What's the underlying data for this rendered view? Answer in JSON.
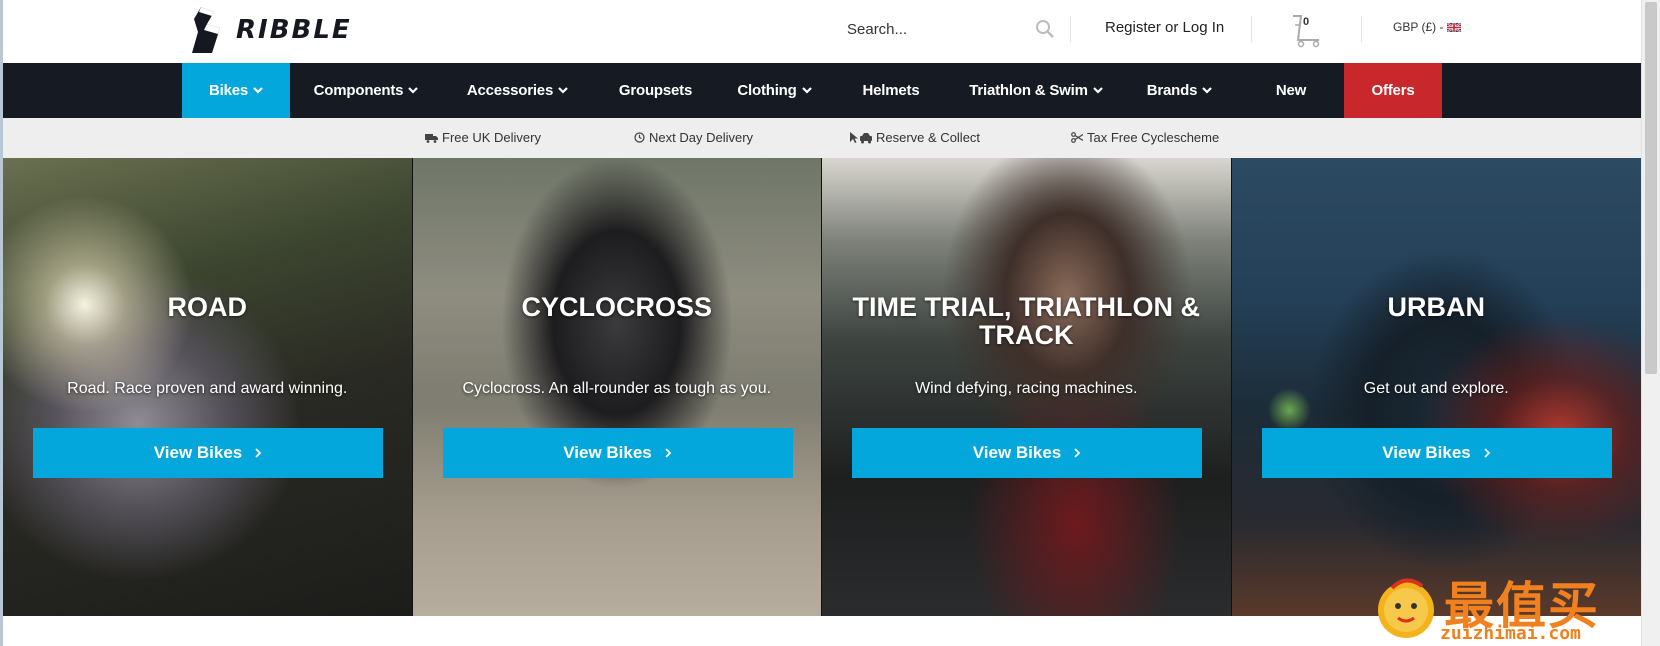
{
  "header": {
    "logo_text": "RIBBLE",
    "search_placeholder": "Search...",
    "login_label": "Register or Log In",
    "cart_count": "0",
    "currency_label": "GBP (£) -"
  },
  "nav": {
    "items": [
      {
        "label": "Bikes",
        "dropdown": true,
        "active": true
      },
      {
        "label": "Components",
        "dropdown": true
      },
      {
        "label": "Accessories",
        "dropdown": true
      },
      {
        "label": "Groupsets",
        "dropdown": false
      },
      {
        "label": "Clothing",
        "dropdown": true
      },
      {
        "label": "Helmets",
        "dropdown": false
      },
      {
        "label": "Triathlon & Swim",
        "dropdown": true
      },
      {
        "label": "Brands",
        "dropdown": true
      },
      {
        "label": "New",
        "dropdown": false
      },
      {
        "label": "Offers",
        "dropdown": false,
        "highlight": true
      }
    ]
  },
  "usps": [
    {
      "icon": "truck-icon",
      "label": "Free UK Delivery"
    },
    {
      "icon": "clock-icon",
      "label": "Next Day Delivery"
    },
    {
      "icon": "pointer-car-icon",
      "label": "Reserve & Collect"
    },
    {
      "icon": "scissors-icon",
      "label": "Tax Free Cyclescheme"
    }
  ],
  "panels": [
    {
      "title": "ROAD",
      "subtitle": "Road. Race proven and award winning.",
      "button": "View Bikes"
    },
    {
      "title": "CYCLOCROSS",
      "subtitle": "Cyclocross. An all-rounder as tough as you.",
      "button": "View Bikes"
    },
    {
      "title": "TIME TRIAL, TRIATHLON & TRACK",
      "subtitle": "Wind defying, racing machines.",
      "button": "View Bikes"
    },
    {
      "title": "URBAN",
      "subtitle": "Get out and explore.",
      "button": "View Bikes"
    }
  ],
  "watermark": {
    "cn": "最值买",
    "url": "zuizhimai.com"
  },
  "colors": {
    "accent": "#03a7dc",
    "nav_bg": "#161a22",
    "offers": "#c8282b",
    "usp_bg": "#eeeeef"
  }
}
